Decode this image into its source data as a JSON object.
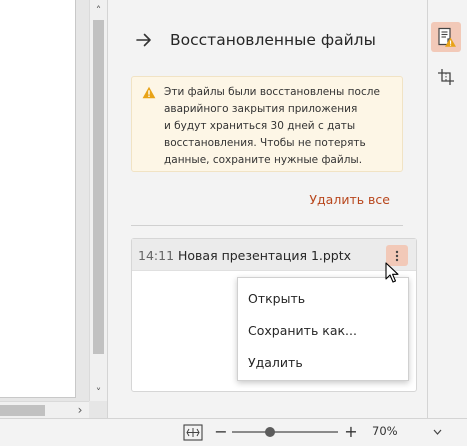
{
  "panel": {
    "title": "Восстановленные файлы",
    "back_icon": "arrow-right-icon",
    "notice": {
      "icon": "warning-triangle-icon",
      "lines": [
        "Эти файлы были восстановлены после",
        "аварийного закрытия приложения",
        "и будут храниться 30 дней с даты",
        "восстановления. Чтобы не потерять",
        "данные, сохраните нужные файлы."
      ]
    },
    "delete_all_label": "Удалить все",
    "files": [
      {
        "time": "14:11",
        "name": "Новая презентация 1.pptx"
      }
    ],
    "more_icon": "more-vertical-icon"
  },
  "context_menu": {
    "items": [
      {
        "label": "Открыть"
      },
      {
        "label": "Сохранить как..."
      },
      {
        "label": "Удалить"
      }
    ]
  },
  "rail": {
    "buttons": [
      {
        "icon": "recovered-file-warning-icon",
        "active": true
      },
      {
        "icon": "crop-icon",
        "active": false
      }
    ]
  },
  "statusbar": {
    "fit_icon": "fit-slide-icon",
    "zoom_percent": 70,
    "zoom_label": "70%",
    "zoom_fraction": 0.36
  },
  "colors": {
    "accent": "#b8461c",
    "active_bg": "#f2c9b8",
    "warning": "#e8a317",
    "notice_bg": "#fdf6e6"
  }
}
